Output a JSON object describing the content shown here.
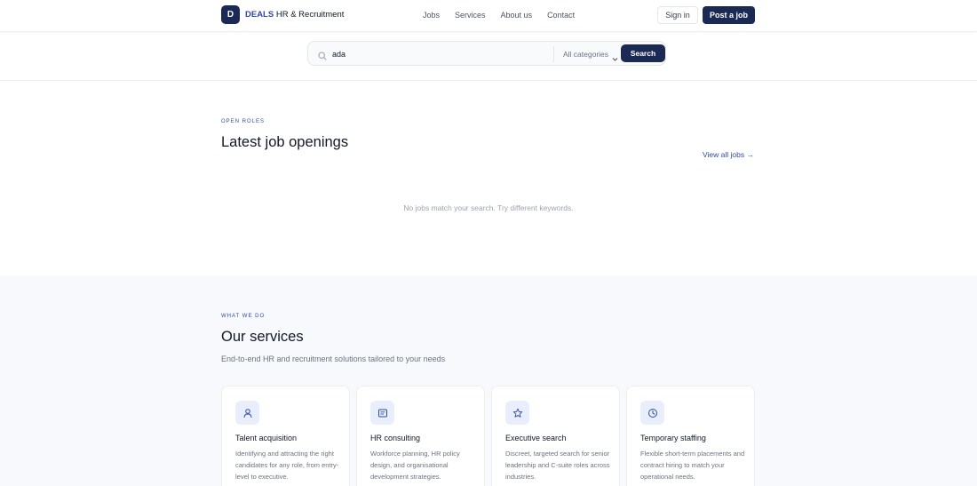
{
  "header": {
    "logo_letter": "D",
    "brand": "DEALS",
    "brand_rest": "HR & Recruitment",
    "nav": [
      "Jobs",
      "Services",
      "About us",
      "Contact"
    ],
    "signin_label": "Sign in",
    "post_label": "Post a job"
  },
  "search": {
    "value": "ada",
    "category": "All categories",
    "button_label": "Search"
  },
  "jobs": {
    "eyebrow": "OPEN ROLES",
    "title": "Latest job openings",
    "view_all": "View all jobs →",
    "empty_message": "No jobs match your search. Try different keywords."
  },
  "services": {
    "eyebrow": "WHAT WE DO",
    "title": "Our services",
    "subtitle": "End-to-end HR and recruitment solutions tailored to your needs",
    "cards": [
      {
        "icon": "user-icon",
        "title": "Talent acquisition",
        "desc": "Identifying and attracting the right candidates for any role, from entry-level to executive."
      },
      {
        "icon": "document-icon",
        "title": "HR consulting",
        "desc": "Workforce planning, HR policy design, and organisational development strategies."
      },
      {
        "icon": "star-icon",
        "title": "Executive search",
        "desc": "Discreet, targeted search for senior leadership and C-suite roles across industries."
      },
      {
        "icon": "clock-icon",
        "title": "Temporary staffing",
        "desc": "Flexible short-term placements and contract hiring to match your operational needs."
      }
    ]
  },
  "colors": {
    "primary": "#1b2a55",
    "accent": "#2f4aa8",
    "muted_text": "#6b7280",
    "section_bg": "#f8f9fc"
  }
}
